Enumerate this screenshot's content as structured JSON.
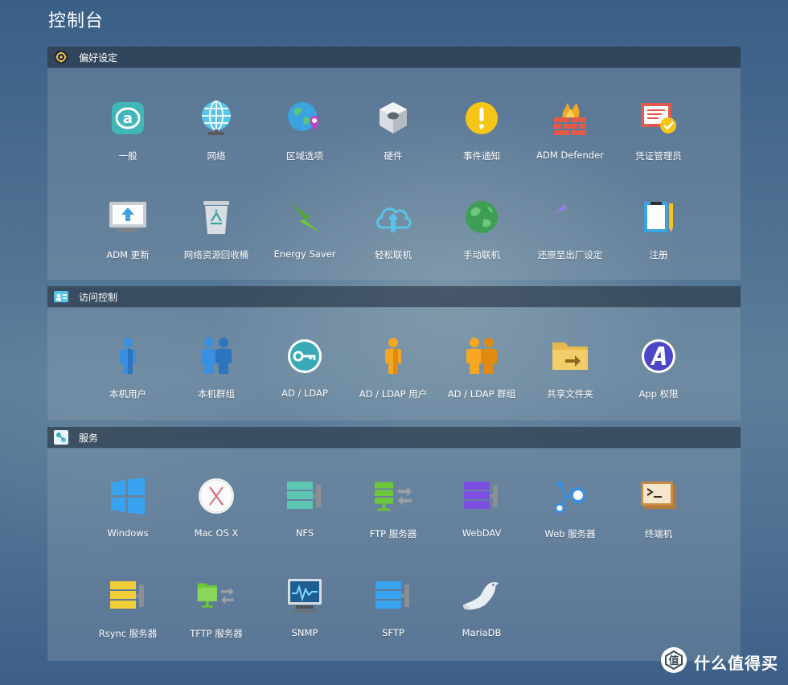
{
  "page": {
    "title": "控制台"
  },
  "sections": [
    {
      "label": "偏好设定",
      "icon": "gear-icon",
      "items": [
        {
          "label": "一般",
          "icon": "general-icon"
        },
        {
          "label": "网络",
          "icon": "globe-network-icon"
        },
        {
          "label": "区域选项",
          "icon": "region-globe-icon"
        },
        {
          "label": "硬件",
          "icon": "hardware-bolt-icon"
        },
        {
          "label": "事件通知",
          "icon": "exclamation-alert-icon"
        },
        {
          "label": "ADM Defender",
          "icon": "firewall-icon"
        },
        {
          "label": "凭证管理员",
          "icon": "certificate-icon"
        },
        {
          "label": "ADM 更新",
          "icon": "monitor-update-icon"
        },
        {
          "label": "网络资源回收桶",
          "icon": "recycle-bin-icon"
        },
        {
          "label": "Energy Saver",
          "icon": "lightning-icon"
        },
        {
          "label": "轻松联机",
          "icon": "cloud-upload-icon"
        },
        {
          "label": "手动联机",
          "icon": "green-globe-icon"
        },
        {
          "label": "还原至出厂设定",
          "icon": "undo-arrow-icon"
        },
        {
          "label": "注册",
          "icon": "registration-icon"
        }
      ]
    },
    {
      "label": "访问控制",
      "icon": "id-card-icon",
      "items": [
        {
          "label": "本机用户",
          "icon": "user-icon"
        },
        {
          "label": "本机群组",
          "icon": "group-icon"
        },
        {
          "label": "AD / LDAP",
          "icon": "key-icon"
        },
        {
          "label": "AD / LDAP 用户",
          "icon": "ad-user-icon"
        },
        {
          "label": "AD / LDAP 群组",
          "icon": "ad-group-icon"
        },
        {
          "label": "共享文件夹",
          "icon": "shared-folder-icon"
        },
        {
          "label": "App 权限",
          "icon": "app-permission-icon"
        }
      ]
    },
    {
      "label": "服务",
      "icon": "services-icon",
      "items": [
        {
          "label": "Windows",
          "icon": "windows-icon"
        },
        {
          "label": "Mac OS X",
          "icon": "mac-os-x-icon"
        },
        {
          "label": "NFS",
          "icon": "nfs-server-icon"
        },
        {
          "label": "FTP 服务器",
          "icon": "ftp-server-icon"
        },
        {
          "label": "WebDAV",
          "icon": "webdav-server-icon"
        },
        {
          "label": "Web 服务器",
          "icon": "web-server-icon"
        },
        {
          "label": "终端机",
          "icon": "terminal-icon"
        },
        {
          "label": "Rsync 服务器",
          "icon": "rsync-server-icon"
        },
        {
          "label": "TFTP 服务器",
          "icon": "tftp-server-icon"
        },
        {
          "label": "SNMP",
          "icon": "snmp-monitor-icon"
        },
        {
          "label": "SFTP",
          "icon": "sftp-server-icon"
        },
        {
          "label": "MariaDB",
          "icon": "mariadb-seal-icon"
        }
      ]
    }
  ],
  "watermark": {
    "text": "什么值得买",
    "icon": "watermark-logo-icon"
  }
}
